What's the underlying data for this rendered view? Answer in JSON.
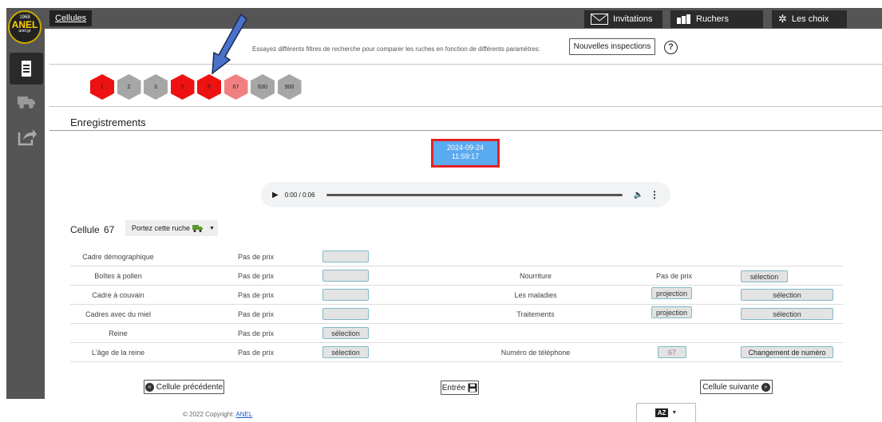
{
  "logo": {
    "year": "1968",
    "name": "ANEL",
    "site": "anel.gr"
  },
  "topbar": {
    "first_tab": "Cellules",
    "invitations": "Invitations",
    "ruchers": "Ruchers",
    "choix": "Les choix"
  },
  "search": {
    "hint": "Essayez différents filtres de recherche pour comparer les ruches en fonction de différents paramètres:",
    "new_inspections": "Nouvelles inspections",
    "help": "?"
  },
  "hives": [
    {
      "label": "1",
      "color": "#ee1111"
    },
    {
      "label": "2",
      "color": "#a6a6a6"
    },
    {
      "label": "3",
      "color": "#a6a6a6"
    },
    {
      "label": "5",
      "color": "#ee1111"
    },
    {
      "label": "6",
      "color": "#ee1111"
    },
    {
      "label": "67",
      "color": "#f08080"
    },
    {
      "label": "630",
      "color": "#a6a6a6"
    },
    {
      "label": "900",
      "color": "#a6a6a6"
    }
  ],
  "recordings": {
    "title": "Enregistrements",
    "date": "2024-09-24",
    "time": "11:59:17",
    "audio_time": "0:00 / 0:06"
  },
  "cell": {
    "label": "Cellule",
    "number": "67",
    "dropdown": "Portez cette ruche"
  },
  "left_rows": [
    {
      "label": "Cadre démographique",
      "price": "Pas de prix",
      "button": ""
    },
    {
      "label": "Boîtes à pollen",
      "price": "Pas de prix",
      "button": ""
    },
    {
      "label": "Cadre à couvain",
      "price": "Pas de prix",
      "button": ""
    },
    {
      "label": "Cadres avec du miel",
      "price": "Pas de prix",
      "button": ""
    },
    {
      "label": "Reine",
      "price": "Pas de prix",
      "button": "sélection"
    },
    {
      "label": "L'âge de la reine",
      "price": "Pas de prix",
      "button": "sélection"
    }
  ],
  "right_rows": [
    {
      "label": "Nourriture",
      "mid": "Pas de prix",
      "button": "sélection"
    },
    {
      "label": "Les maladies",
      "mid": "projection",
      "button": "sélection"
    },
    {
      "label": "Traitements",
      "mid": "projection",
      "button": "sélection"
    },
    {
      "label": "Numéro de téléphone",
      "mid": "67",
      "button": "Changement de numéro"
    }
  ],
  "nav": {
    "prev": "Cellule précédente",
    "enter": "Entrée",
    "next": "Cellule suivante"
  },
  "footer": {
    "copyright": "© 2022 Copyright:",
    "link": "ANEL"
  },
  "language": {
    "icon": "AZ"
  }
}
